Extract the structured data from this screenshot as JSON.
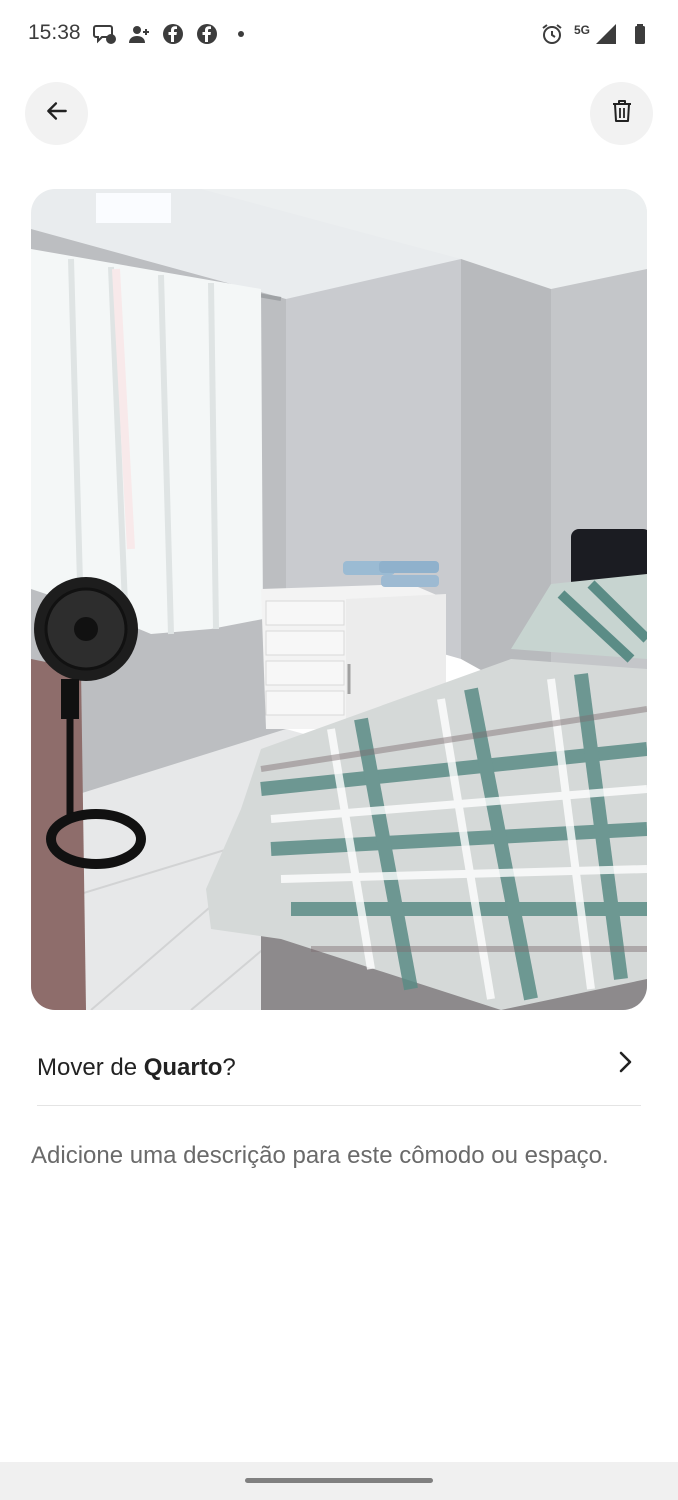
{
  "status_bar": {
    "time": "15:38",
    "network": "5G",
    "left_icons": [
      "chat-icon",
      "add-contact-icon",
      "facebook-icon",
      "facebook-icon",
      "dot-icon"
    ],
    "right_icons": [
      "alarm-icon",
      "signal-icon",
      "battery-icon"
    ]
  },
  "header": {
    "back_icon": "arrow-left-icon",
    "delete_icon": "trash-icon"
  },
  "photo": {
    "subject": "bedroom"
  },
  "move_row": {
    "prefix": "Mover de ",
    "room": "Quarto",
    "suffix": "?"
  },
  "description": {
    "placeholder": "Adicione uma descrição para este cômodo ou espaço."
  },
  "colors": {
    "text": "#222222",
    "muted_text": "#6a6a6a",
    "button_bg": "#f2f2f2",
    "divider": "#e4e4e4"
  }
}
